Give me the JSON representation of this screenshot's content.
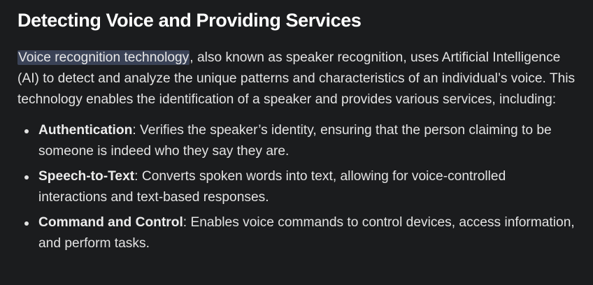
{
  "heading": "Detecting Voice and Providing Services",
  "intro": {
    "highlighted": "Voice recognition technology",
    "rest": ", also known as speaker recognition, uses Artificial Intelligence (AI) to detect and analyze the unique patterns and characteristics of an individual’s voice. This technology enables the identification of a speaker and provides various services, including:"
  },
  "services": [
    {
      "term": "Authentication",
      "description": ": Verifies the speaker’s identity, ensuring that the person claiming to be someone is indeed who they say they are."
    },
    {
      "term": "Speech-to-Text",
      "description": ": Converts spoken words into text, allowing for voice-controlled interactions and text-based responses."
    },
    {
      "term": "Command and Control",
      "description": ": Enables voice commands to control devices, access information, and perform tasks."
    }
  ],
  "colors": {
    "background": "#1b1c1e",
    "text": "#e3e3e3",
    "highlight": "#3a4256"
  }
}
